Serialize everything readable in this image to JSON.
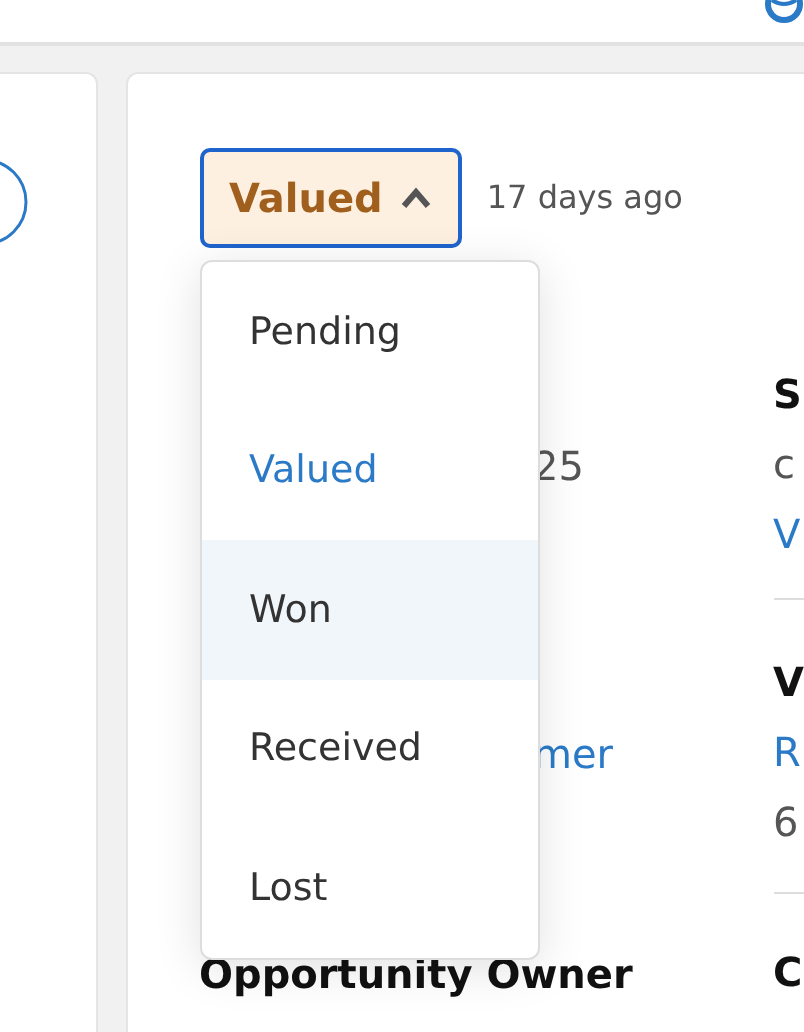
{
  "status_button": {
    "label": "Valued",
    "expanded": true
  },
  "updated": "17 days ago",
  "status_menu": [
    {
      "label": "Pending",
      "selected": false,
      "highlighted": false
    },
    {
      "label": "Valued",
      "selected": true,
      "highlighted": false
    },
    {
      "label": "Won",
      "selected": false,
      "highlighted": true
    },
    {
      "label": "Received",
      "selected": false,
      "highlighted": false
    },
    {
      "label": "Lost",
      "selected": false,
      "highlighted": false
    }
  ],
  "rows": [
    {
      "column_1": {
        "text": "25",
        "kind": "text"
      },
      "column_2": [
        {
          "text": "S",
          "kind": "heading"
        },
        {
          "text": "c",
          "kind": "text"
        },
        {
          "text": "V",
          "kind": "link"
        }
      ]
    },
    {
      "column_1": {
        "text": "mer",
        "kind": "link"
      },
      "column_2": [
        {
          "text": "V",
          "kind": "heading"
        },
        {
          "text": "R",
          "kind": "link"
        },
        {
          "text": "6",
          "kind": "text"
        }
      ]
    },
    {
      "column_1": {
        "text": "Opportunity Owner",
        "kind": "heading"
      },
      "column_2": [
        {
          "text": "C",
          "kind": "heading"
        }
      ]
    }
  ]
}
